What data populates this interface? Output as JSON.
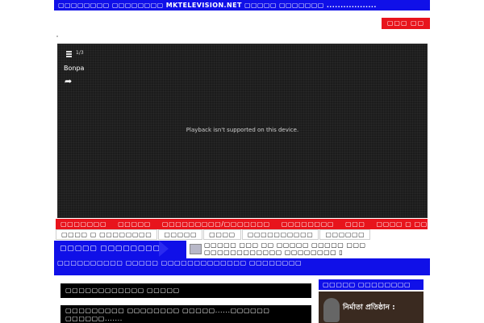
{
  "header": {
    "marquee_text": "▢▢▢▢▢▢▢▢ ▢▢▢▢▢▢▢▢ MKTELEVISION.NET ▢▢▢▢▢ ▢▢▢▢▢▢▢ ..................",
    "button_label": "▢▢▢ ▢▢"
  },
  "player": {
    "playlist_count": "1/3",
    "title": "Bonpa",
    "message": "Playback isn't supported on this device."
  },
  "nav_primary": [
    {
      "label": "▢▢▢▢▢▢▢"
    },
    {
      "label": "▢▢▢▢▢"
    },
    {
      "label": "▢▢▢▢▢▢▢▢▢/▢▢▢▢▢▢▢"
    },
    {
      "label": "▢▢▢▢▢▢▢▢"
    },
    {
      "label": "▢▢▢"
    },
    {
      "label": "▢▢▢▢ ▢ ▢▢▢▢▢▢"
    }
  ],
  "nav_secondary": [
    {
      "label": "▢▢▢▢ ▢ ▢▢▢▢▢▢▢▢"
    },
    {
      "label": "▢▢▢▢▢"
    },
    {
      "label": "▢▢▢▢"
    },
    {
      "label": "▢▢▢▢▢▢▢▢▢▢"
    },
    {
      "label": "▢▢▢▢▢▢"
    }
  ],
  "breaking": {
    "label": "▢▢▢▢▢ ▢▢▢▢▢▢▢▢ :",
    "headline": "▢▢▢▢▢ ▢▢▢ ▢▢ ▢▢▢▢▢ ▢▢▢▢▢ ▢▢▢ ▢▢▢▢▢▢▢▢▢▢▢▢ ▢▢▢▢▢▢▢▢ ▯",
    "subline": "▢▢▢▢▢▢▢▢▢▢ ▢▢▢▢▢ ▢▢▢▢▢▢▢▢▢▢▢▢▢ ▢▢▢▢▢▢▢▢"
  },
  "main": {
    "section_title": "▢▢▢▢▢▢▢▢▢▢▢▢ ▢▢▢▢▢",
    "post_title": "▢▢▢▢▢▢▢▢▢ ▢▢▢▢▢▢▢▢ ▢▢▢▢▢......▢▢▢▢▢▢ ▢▢▢▢▢▢......."
  },
  "sidebar": {
    "title": "▢▢▢▢▢ ▢▢▢▢▢▢▢▢",
    "image_caption": "নির্মাতা প্রতিষ্ঠান :"
  },
  "colors": {
    "brand_blue": "#1010e8",
    "brand_red": "#e8141c",
    "player_bg": "#1c1c1c"
  }
}
